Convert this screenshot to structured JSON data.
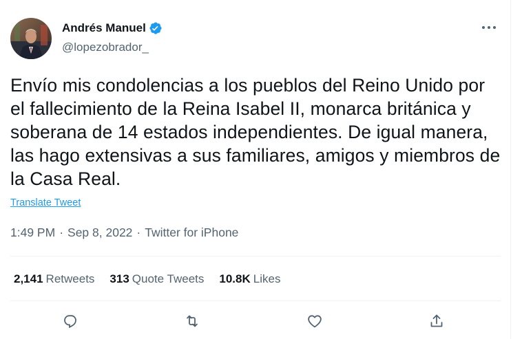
{
  "author": {
    "name": "Andrés Manuel",
    "handle": "@lopezobrador_"
  },
  "tweet": {
    "text": "Envío mis condolencias a los pueblos del Reino Unido por el fallecimiento de la Reina Isabel II, monarca británica y soberana de 14 estados independientes. De igual manera, las hago extensivas a sus familiares, amigos y miembros de la Casa Real.",
    "translate_label": "Translate Tweet",
    "time": "1:49 PM",
    "date": "Sep 8, 2022",
    "source": "Twitter for iPhone",
    "separator": "·"
  },
  "stats": {
    "retweets_count": "2,141",
    "retweets_label": "Retweets",
    "quotes_count": "313",
    "quotes_label": "Quote Tweets",
    "likes_count": "10.8K",
    "likes_label": "Likes"
  },
  "icons": {
    "verified": "verified-badge-icon",
    "more": "more-options-icon",
    "reply": "reply-icon",
    "retweet": "retweet-icon",
    "like": "heart-icon",
    "share": "share-icon"
  },
  "colors": {
    "accent": "#1d9bf0",
    "text": "#0f1419",
    "secondary": "#536471",
    "divider": "#eff3f4"
  }
}
